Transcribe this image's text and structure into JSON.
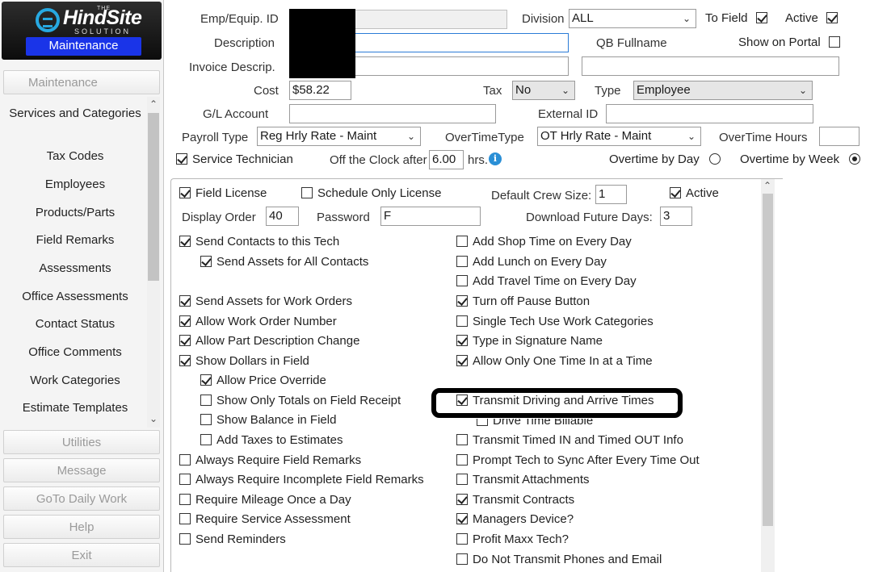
{
  "logo": {
    "the": "THE",
    "brand": "HindSite",
    "sub": "SOLUTION",
    "module_button": "Maintenance"
  },
  "sidebar": {
    "maintenance_header": "Maintenance",
    "items": [
      "Services and Categories",
      "Tax Codes",
      "Employees",
      "Products/Parts",
      "Field Remarks",
      "Assessments",
      "Office Assessments",
      "Contact Status",
      "Office Comments",
      "Work Categories",
      "Estimate Templates"
    ],
    "sections": [
      "Utilities",
      "Message",
      "GoTo Daily Work",
      "Help",
      "Exit"
    ]
  },
  "form": {
    "emp_id_label": "Emp/Equip. ID",
    "description_label": "Description",
    "invoice_label": "Invoice Descrip.",
    "division_label": "Division",
    "division_value": "ALL",
    "to_field_label": "To Field",
    "active_label": "Active",
    "qb_fullname_label": "QB Fullname",
    "show_portal_label": "Show on Portal",
    "cost_label": "Cost",
    "cost_value": "$58.22",
    "tax_label": "Tax",
    "tax_value": "No",
    "type_label": "Type",
    "type_value": "Employee",
    "gl_label": "G/L Account",
    "external_id_label": "External ID",
    "payroll_label": "Payroll Type",
    "payroll_value": "Reg Hrly Rate - Maint",
    "overtime_type_label": "OverTimeType",
    "overtime_type_value": "OT Hrly Rate - Maint",
    "overtime_hours_label": "OverTime Hours",
    "service_tech_label": "Service Technician",
    "off_clock_label": "Off the Clock after",
    "off_clock_value": "6.00",
    "hrs_label": "hrs.",
    "ot_day_label": "Overtime by Day",
    "ot_week_label": "Overtime by Week"
  },
  "panel": {
    "field_license": "Field License",
    "schedule_only": "Schedule Only License",
    "crew_size_label": "Default Crew Size:",
    "crew_size_value": "1",
    "active_label": "Active",
    "display_order_label": "Display Order",
    "display_order_value": "40",
    "password_label": "Password",
    "password_value": "F",
    "download_label": "Download Future Days:",
    "download_value": "3",
    "left_options": [
      {
        "label": "Send Contacts to this Tech",
        "checked": true
      },
      {
        "label": "Send Assets for All Contacts",
        "checked": true
      },
      {
        "label": "Send Assets for Work Orders",
        "checked": true
      },
      {
        "label": "Allow Work Order Number",
        "checked": true
      },
      {
        "label": "Allow Part Description Change",
        "checked": true
      },
      {
        "label": "Show Dollars in Field",
        "checked": true
      },
      {
        "label": "Allow Price Override",
        "checked": true
      },
      {
        "label": "Show Only Totals on Field Receipt",
        "checked": false
      },
      {
        "label": "Show Balance in Field",
        "checked": false
      },
      {
        "label": "Add Taxes to Estimates",
        "checked": false
      },
      {
        "label": "Always Require Field Remarks",
        "checked": false
      },
      {
        "label": "Always Require Incomplete Field Remarks",
        "checked": false
      },
      {
        "label": "Require Mileage Once a Day",
        "checked": false
      },
      {
        "label": "Require Service Assessment",
        "checked": false
      },
      {
        "label": "Send Reminders",
        "checked": false
      }
    ],
    "right_options": [
      {
        "label": "Add Shop Time on Every Day",
        "checked": false
      },
      {
        "label": "Add Lunch on Every Day",
        "checked": false
      },
      {
        "label": "Add Travel Time on Every Day",
        "checked": false
      },
      {
        "label": "Turn off Pause Button",
        "checked": true
      },
      {
        "label": "Single Tech Use Work Categories",
        "checked": false
      },
      {
        "label": "Type in Signature Name",
        "checked": true
      },
      {
        "label": "Allow Only One Time In at a Time",
        "checked": true
      },
      {
        "label": "Transmit Driving and Arrive Times",
        "checked": true
      },
      {
        "label": "Drive Time Billable",
        "checked": false
      },
      {
        "label": "Transmit Timed IN and Timed OUT Info",
        "checked": false
      },
      {
        "label": "Prompt Tech to Sync After Every Time Out",
        "checked": false
      },
      {
        "label": "Transmit Attachments",
        "checked": false
      },
      {
        "label": "Transmit Contracts",
        "checked": true
      },
      {
        "label": "Managers Device?",
        "checked": true
      },
      {
        "label": "Profit Maxx Tech?",
        "checked": false
      },
      {
        "label": "Do Not Transmit Phones and Email",
        "checked": false
      }
    ]
  },
  "icons": {
    "info": "info-icon",
    "dropdown": "chevron-down-icon",
    "scroll_up": "scroll-up-icon",
    "scroll_down": "scroll-down-icon"
  },
  "colors": {
    "module_button": "#1a34e8",
    "info": "#2a8fd6",
    "accent_border": "#2a7bd6"
  }
}
